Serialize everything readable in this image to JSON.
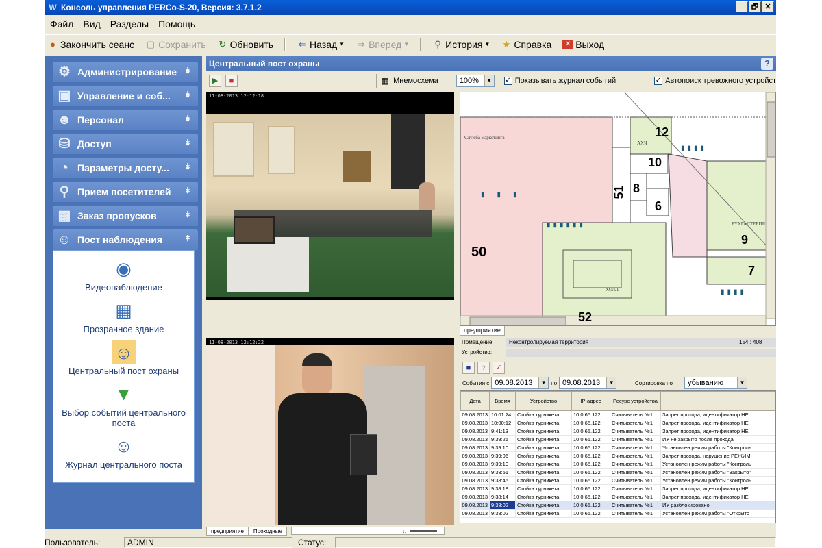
{
  "window": {
    "title": "Консоль управления PERCo-S-20, Версия: 3.7.1.2",
    "buttons": [
      "_",
      "🗗",
      "✕"
    ]
  },
  "menu": [
    "Файл",
    "Вид",
    "Разделы",
    "Помощь"
  ],
  "toolbar": {
    "end_session": "Закончить сеанс",
    "save": "Сохранить",
    "refresh": "Обновить",
    "back": "Назад",
    "forward": "Вперед",
    "history": "История",
    "help": "Справка",
    "exit": "Выход"
  },
  "sidebar": {
    "items": [
      {
        "label": "Администрирование",
        "icon": "gears-icon"
      },
      {
        "label": "Управление и соб...",
        "icon": "monitor-icon"
      },
      {
        "label": "Персонал",
        "icon": "people-icon"
      },
      {
        "label": "Доступ",
        "icon": "lock-icon"
      },
      {
        "label": "Параметры досту...",
        "icon": "pie-chart-icon"
      },
      {
        "label": "Прием посетителей",
        "icon": "magnifier-icon"
      },
      {
        "label": "Заказ пропусков",
        "icon": "id-card-icon"
      },
      {
        "label": "Пост наблюдения",
        "icon": "guard-icon"
      }
    ],
    "sub_items": [
      {
        "label": "Видеонаблюдение",
        "icon": "camera-icon"
      },
      {
        "label": "Прозрачное здание",
        "icon": "building-icon"
      },
      {
        "label": "Центральный пост охраны",
        "icon": "guard-post-icon",
        "active": true
      },
      {
        "label": "Выбор событий центрального поста",
        "icon": "filter-icon"
      },
      {
        "label": "Журнал центрального поста",
        "icon": "journal-icon"
      }
    ]
  },
  "main": {
    "title": "Центральный пост охраны",
    "mnemo": "Мнемосхема",
    "zoom": "100%",
    "show_journal": "Показывать журнал событий",
    "autosearch": "Автопоиск тревожного устройст",
    "osd1": "11-08-2013 12:12:18",
    "osd2": "11-08-2013 12:12:22"
  },
  "map": {
    "rooms": [
      "50",
      "51",
      "52",
      "12",
      "10",
      "8",
      "6",
      "9",
      "7"
    ],
    "labels": [
      "Служба маркетинга",
      "АХЧ",
      "БУХГАЛТЕРИЯ",
      "ХОЛЛ"
    ],
    "tabs": [
      "предприятие"
    ]
  },
  "info": {
    "room_label": "Помещение:",
    "room_value": "Неконтролируемая территория",
    "coords": "154 : 408",
    "device_label": "Устройство:"
  },
  "filter": {
    "events_from": "События с",
    "date_from": "09.08.2013",
    "to": "по",
    "date_to": "09.08.2013",
    "sort": "Сортировка по",
    "sort_value": "убыванию"
  },
  "grid": {
    "columns": [
      "Дата",
      "Время",
      "Устройство",
      "IP-адрес",
      "Ресурс устройства",
      ""
    ],
    "rows": [
      [
        "09.08.2013",
        "10:01:24",
        "Стойка турникета",
        "10.0.65.122",
        "Считыватель №1",
        "Запрет прохода, идентификатор НЕ"
      ],
      [
        "09.08.2013",
        "10:00:12",
        "Стойка турникета",
        "10.0.65.122",
        "Считыватель №1",
        "Запрет прохода, идентификатор НЕ"
      ],
      [
        "09.08.2013",
        "9:41:13",
        "Стойка турникета",
        "10.0.65.122",
        "Считыватель №1",
        "Запрет прохода, идентификатор НЕ"
      ],
      [
        "09.08.2013",
        "9:39:25",
        "Стойка турникета",
        "10.0.65.122",
        "Считыватель №1",
        "ИУ не закрыто после прохода"
      ],
      [
        "09.08.2013",
        "9:39:10",
        "Стойка турникета",
        "10.0.65.122",
        "Считыватель №1",
        "Установлен режим работы \"Контроль"
      ],
      [
        "09.08.2013",
        "9:39:06",
        "Стойка турникета",
        "10.0.65.122",
        "Считыватель №1",
        "Запрет прохода, нарушение РЕЖИМ"
      ],
      [
        "09.08.2013",
        "9:39:10",
        "Стойка турникета",
        "10.0.65.122",
        "Считыватель №1",
        "Установлен режим работы \"Контроль"
      ],
      [
        "09.08.2013",
        "9:38:51",
        "Стойка турникета",
        "10.0.65.122",
        "Считыватель №1",
        "Установлен режим работы \"Закрыто\""
      ],
      [
        "09.08.2013",
        "9:38:45",
        "Стойка турникета",
        "10.0.65.122",
        "Считыватель №1",
        "Установлен режим работы \"Контроль"
      ],
      [
        "09.08.2013",
        "9:38:18",
        "Стойка турникета",
        "10.0.65.122",
        "Считыватель №1",
        "Запрет прохода, идентификатор НЕ"
      ],
      [
        "09.08.2013",
        "9:38:14",
        "Стойка турникета",
        "10.0.65.122",
        "Считыватель №1",
        "Запрет прохода, идентификатор НЕ"
      ],
      [
        "09.08.2013",
        "9:38:02",
        "Стойка турникета",
        "10.0.65.122",
        "Считыватель №1",
        "ИУ разблокировано"
      ],
      [
        "09.08.2013",
        "9:38:02",
        "Стойка турникета",
        "10.0.65.122",
        "Считыватель №1",
        "Установлен режим работы \"Открыто"
      ]
    ],
    "selected_row": 11
  },
  "bottom_tabs": [
    "предприятие",
    "Проходные"
  ],
  "status": {
    "user_label": "Пользователь:",
    "user": "ADMIN",
    "status_label": "Статус:"
  },
  "colors": {
    "sidebar": "#4a73b7",
    "titlebar": "#0846b5",
    "map_pink": "#f8d7d7",
    "map_green": "#e4f0cc"
  }
}
